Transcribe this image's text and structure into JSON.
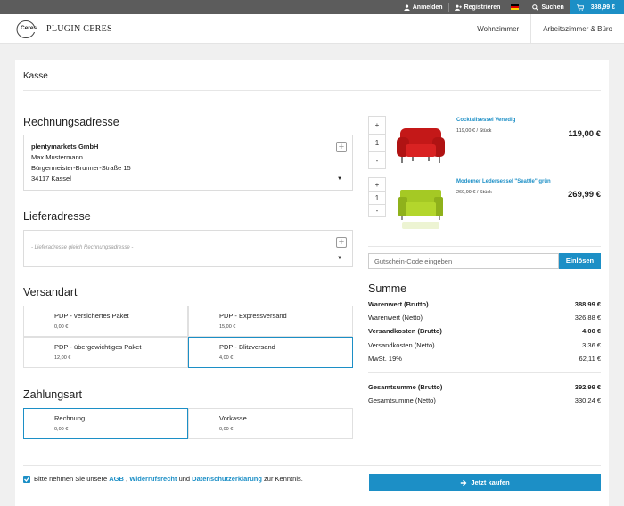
{
  "topbar": {
    "login": "Anmelden",
    "register": "Registrieren",
    "language_icon": "german-flag-icon",
    "search": "Suchen",
    "cart_total": "388,99 €"
  },
  "header": {
    "logo_text": "PLUGIN CERES",
    "logo_badge": "Ceres",
    "nav": [
      "Wohnzimmer",
      "Arbeitszimmer & Büro"
    ]
  },
  "page": {
    "title": "Kasse"
  },
  "billing": {
    "heading": "Rechnungsadresse",
    "lines": [
      "plentymarkets GmbH",
      "Max Mustermann",
      "Bürgermeister-Brunner-Straße 15",
      "34117 Kassel"
    ]
  },
  "delivery": {
    "heading": "Lieferadresse",
    "placeholder": "- Lieferadresse gleich Rechnungsadresse -"
  },
  "shipping": {
    "heading": "Versandart",
    "options": [
      {
        "name": "PDP - versichertes Paket",
        "price": "0,00 €"
      },
      {
        "name": "PDP - Expressversand",
        "price": "15,00 €"
      },
      {
        "name": "PDP - übergewichtiges Paket",
        "price": "12,00 €"
      },
      {
        "name": "PDP - Blitzversand",
        "price": "4,00 €",
        "selected": true
      }
    ]
  },
  "payment": {
    "heading": "Zahlungsart",
    "options": [
      {
        "name": "Rechnung",
        "price": "0,00 €",
        "selected": true
      },
      {
        "name": "Vorkasse",
        "price": "0,00 €"
      }
    ]
  },
  "basket": {
    "items": [
      {
        "name": "Cocktailsessel Venedig",
        "unit_price": "119,00 € / Stück",
        "qty": "1",
        "total": "119,00 €",
        "color": "#cc1b1b"
      },
      {
        "name": "Moderner Ledersessel \"Seattle\" grün",
        "unit_price": "269,99 € / Stück",
        "qty": "1",
        "total": "269,99 €",
        "color": "#9cc31f"
      }
    ],
    "plus": "+",
    "minus": "-"
  },
  "coupon": {
    "placeholder": "Gutschein-Code eingeben",
    "button": "Einlösen"
  },
  "summary": {
    "heading": "Summe",
    "rows": [
      {
        "label": "Warenwert (Brutto)",
        "value": "388,99 €",
        "bold": true
      },
      {
        "label": "Warenwert (Netto)",
        "value": "326,88 €"
      },
      {
        "label": "Versandkosten (Brutto)",
        "value": "4,00 €",
        "bold": true
      },
      {
        "label": "Versandkosten (Netto)",
        "value": "3,36 €"
      },
      {
        "label": "MwSt. 19%",
        "value": "62,11 €"
      }
    ],
    "totals": [
      {
        "label": "Gesamtsumme (Brutto)",
        "value": "392,99 €",
        "bold": true
      },
      {
        "label": "Gesamtsumme (Netto)",
        "value": "330,24 €"
      }
    ]
  },
  "terms": {
    "prefix": "Bitte nehmen Sie unsere",
    "agb": "AGB",
    "sep1": ",",
    "withdrawal": "Widerrufsrecht",
    "and": "und",
    "privacy": "Datenschutzerklärung",
    "suffix": "zur Kenntnis."
  },
  "buy_button": "Jetzt kaufen"
}
